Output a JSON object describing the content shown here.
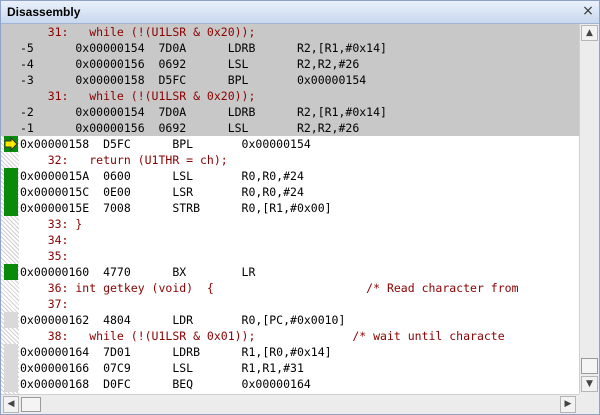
{
  "window": {
    "title": "Disassembly",
    "close_glyph": "×"
  },
  "lines": [
    {
      "kind": "src",
      "bg": "gray",
      "mark": "none",
      "text": "    31:   while (!(U1LSR & 0x20));"
    },
    {
      "kind": "asm",
      "bg": "gray",
      "mark": "none",
      "text": "-5      0x00000154  7D0A      LDRB      R2,[R1,#0x14]"
    },
    {
      "kind": "asm",
      "bg": "gray",
      "mark": "none",
      "text": "-4      0x00000156  0692      LSL       R2,R2,#26"
    },
    {
      "kind": "asm",
      "bg": "gray",
      "mark": "none",
      "text": "-3      0x00000158  D5FC      BPL       0x00000154"
    },
    {
      "kind": "src",
      "bg": "gray",
      "mark": "none",
      "text": "    31:   while (!(U1LSR & 0x20));"
    },
    {
      "kind": "asm",
      "bg": "gray",
      "mark": "none",
      "text": "-2      0x00000154  7D0A      LDRB      R2,[R1,#0x14]"
    },
    {
      "kind": "asm",
      "bg": "gray",
      "mark": "none",
      "text": "-1      0x00000156  0692      LSL       R2,R2,#26"
    },
    {
      "kind": "asm",
      "bg": "white",
      "mark": "arrow",
      "text": "0x00000158  D5FC      BPL       0x00000154"
    },
    {
      "kind": "src",
      "bg": "white",
      "mark": "none",
      "text": "    32:   return (U1THR = ch);"
    },
    {
      "kind": "asm",
      "bg": "white",
      "mark": "green",
      "text": "0x0000015A  0600      LSL       R0,R0,#24"
    },
    {
      "kind": "asm",
      "bg": "white",
      "mark": "green",
      "text": "0x0000015C  0E00      LSR       R0,R0,#24"
    },
    {
      "kind": "asm",
      "bg": "white",
      "mark": "green",
      "text": "0x0000015E  7008      STRB      R0,[R1,#0x00]"
    },
    {
      "kind": "src",
      "bg": "white",
      "mark": "none",
      "text": "    33: }"
    },
    {
      "kind": "src",
      "bg": "white",
      "mark": "none",
      "text": "    34:"
    },
    {
      "kind": "src",
      "bg": "white",
      "mark": "none",
      "text": "    35:"
    },
    {
      "kind": "asm",
      "bg": "white",
      "mark": "green",
      "text": "0x00000160  4770      BX        LR"
    },
    {
      "kind": "src",
      "bg": "white",
      "mark": "none",
      "text": "    36: int getkey (void)  {                      /* Read character from"
    },
    {
      "kind": "src",
      "bg": "white",
      "mark": "none",
      "text": "    37:"
    },
    {
      "kind": "asm",
      "bg": "white",
      "mark": "light",
      "text": "0x00000162  4804      LDR       R0,[PC,#0x0010]"
    },
    {
      "kind": "src",
      "bg": "white",
      "mark": "none",
      "text": "    38:   while (!(U1LSR & 0x01));              /* wait until characte"
    },
    {
      "kind": "asm",
      "bg": "white",
      "mark": "light",
      "text": "0x00000164  7D01      LDRB      R1,[R0,#0x14]"
    },
    {
      "kind": "asm",
      "bg": "white",
      "mark": "light",
      "text": "0x00000166  07C9      LSL       R1,R1,#31"
    },
    {
      "kind": "asm",
      "bg": "white",
      "mark": "light",
      "text": "0x00000168  D0FC      BEQ       0x00000164"
    }
  ],
  "scroll": {
    "up_glyph": "▲",
    "down_glyph": "▼",
    "left_glyph": "◀",
    "right_glyph": "▶"
  },
  "colors": {
    "source_text": "#8b0000",
    "asm_text": "#000000",
    "executed_mark": "#0a8a0a",
    "past_bg": "#c8c8c8"
  }
}
